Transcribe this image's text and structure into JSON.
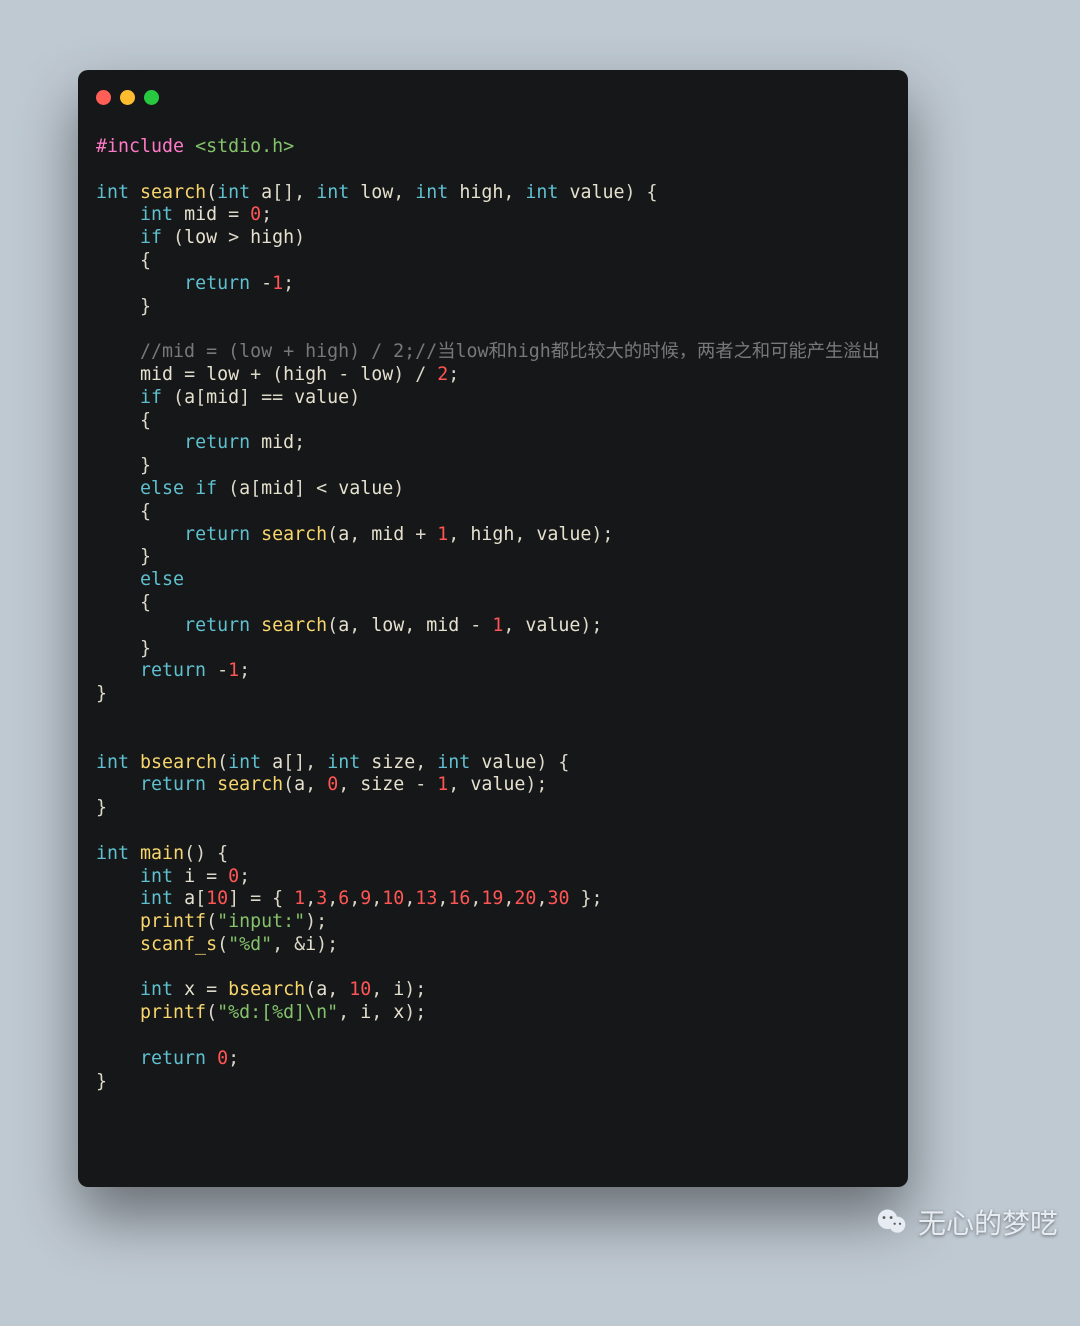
{
  "window": {
    "traffic_lights": [
      "red",
      "yellow",
      "green"
    ],
    "language": "c"
  },
  "code": {
    "tokens": [
      [
        [
          "pp",
          "#include"
        ],
        [
          "pun",
          " "
        ],
        [
          "inc",
          "<stdio.h>"
        ]
      ],
      [],
      [
        [
          "kw",
          "int"
        ],
        [
          "pun",
          " "
        ],
        [
          "fn",
          "search"
        ],
        [
          "pun",
          "("
        ],
        [
          "kw",
          "int"
        ],
        [
          "pun",
          " "
        ],
        [
          "var",
          "a"
        ],
        [
          "pun",
          "[], "
        ],
        [
          "kw",
          "int"
        ],
        [
          "pun",
          " "
        ],
        [
          "var",
          "low"
        ],
        [
          "pun",
          ", "
        ],
        [
          "kw",
          "int"
        ],
        [
          "pun",
          " "
        ],
        [
          "var",
          "high"
        ],
        [
          "pun",
          ", "
        ],
        [
          "kw",
          "int"
        ],
        [
          "pun",
          " "
        ],
        [
          "var",
          "value"
        ],
        [
          "pun",
          ") {"
        ]
      ],
      [
        [
          "pun",
          "    "
        ],
        [
          "kw",
          "int"
        ],
        [
          "pun",
          " "
        ],
        [
          "var",
          "mid"
        ],
        [
          "pun",
          " = "
        ],
        [
          "num",
          "0"
        ],
        [
          "pun",
          ";"
        ]
      ],
      [
        [
          "pun",
          "    "
        ],
        [
          "kw",
          "if"
        ],
        [
          "pun",
          " ("
        ],
        [
          "var",
          "low"
        ],
        [
          "pun",
          " > "
        ],
        [
          "var",
          "high"
        ],
        [
          "pun",
          ")"
        ]
      ],
      [
        [
          "pun",
          "    {"
        ]
      ],
      [
        [
          "pun",
          "        "
        ],
        [
          "kw",
          "return"
        ],
        [
          "pun",
          " -"
        ],
        [
          "num",
          "1"
        ],
        [
          "pun",
          ";"
        ]
      ],
      [
        [
          "pun",
          "    }"
        ]
      ],
      [],
      [
        [
          "pun",
          "    "
        ],
        [
          "cmt",
          "//mid = (low + high) / 2;//当low和high都比较大的时候，两者之和可能产生溢出"
        ]
      ],
      [
        [
          "pun",
          "    "
        ],
        [
          "var",
          "mid"
        ],
        [
          "pun",
          " = "
        ],
        [
          "var",
          "low"
        ],
        [
          "pun",
          " + ("
        ],
        [
          "var",
          "high"
        ],
        [
          "pun",
          " - "
        ],
        [
          "var",
          "low"
        ],
        [
          "pun",
          ") / "
        ],
        [
          "num",
          "2"
        ],
        [
          "pun",
          ";"
        ]
      ],
      [
        [
          "pun",
          "    "
        ],
        [
          "kw",
          "if"
        ],
        [
          "pun",
          " ("
        ],
        [
          "var",
          "a"
        ],
        [
          "pun",
          "["
        ],
        [
          "var",
          "mid"
        ],
        [
          "pun",
          "] == "
        ],
        [
          "var",
          "value"
        ],
        [
          "pun",
          ")"
        ]
      ],
      [
        [
          "pun",
          "    {"
        ]
      ],
      [
        [
          "pun",
          "        "
        ],
        [
          "kw",
          "return"
        ],
        [
          "pun",
          " "
        ],
        [
          "var",
          "mid"
        ],
        [
          "pun",
          ";"
        ]
      ],
      [
        [
          "pun",
          "    }"
        ]
      ],
      [
        [
          "pun",
          "    "
        ],
        [
          "kw",
          "else"
        ],
        [
          "pun",
          " "
        ],
        [
          "kw",
          "if"
        ],
        [
          "pun",
          " ("
        ],
        [
          "var",
          "a"
        ],
        [
          "pun",
          "["
        ],
        [
          "var",
          "mid"
        ],
        [
          "pun",
          "] < "
        ],
        [
          "var",
          "value"
        ],
        [
          "pun",
          ")"
        ]
      ],
      [
        [
          "pun",
          "    {"
        ]
      ],
      [
        [
          "pun",
          "        "
        ],
        [
          "kw",
          "return"
        ],
        [
          "pun",
          " "
        ],
        [
          "fn",
          "search"
        ],
        [
          "pun",
          "("
        ],
        [
          "var",
          "a"
        ],
        [
          "pun",
          ", "
        ],
        [
          "var",
          "mid"
        ],
        [
          "pun",
          " + "
        ],
        [
          "num",
          "1"
        ],
        [
          "pun",
          ", "
        ],
        [
          "var",
          "high"
        ],
        [
          "pun",
          ", "
        ],
        [
          "var",
          "value"
        ],
        [
          "pun",
          ");"
        ]
      ],
      [
        [
          "pun",
          "    }"
        ]
      ],
      [
        [
          "pun",
          "    "
        ],
        [
          "kw",
          "else"
        ]
      ],
      [
        [
          "pun",
          "    {"
        ]
      ],
      [
        [
          "pun",
          "        "
        ],
        [
          "kw",
          "return"
        ],
        [
          "pun",
          " "
        ],
        [
          "fn",
          "search"
        ],
        [
          "pun",
          "("
        ],
        [
          "var",
          "a"
        ],
        [
          "pun",
          ", "
        ],
        [
          "var",
          "low"
        ],
        [
          "pun",
          ", "
        ],
        [
          "var",
          "mid"
        ],
        [
          "pun",
          " - "
        ],
        [
          "num",
          "1"
        ],
        [
          "pun",
          ", "
        ],
        [
          "var",
          "value"
        ],
        [
          "pun",
          ");"
        ]
      ],
      [
        [
          "pun",
          "    }"
        ]
      ],
      [
        [
          "pun",
          "    "
        ],
        [
          "kw",
          "return"
        ],
        [
          "pun",
          " -"
        ],
        [
          "num",
          "1"
        ],
        [
          "pun",
          ";"
        ]
      ],
      [
        [
          "pun",
          "}"
        ]
      ],
      [],
      [],
      [
        [
          "kw",
          "int"
        ],
        [
          "pun",
          " "
        ],
        [
          "fn",
          "bsearch"
        ],
        [
          "pun",
          "("
        ],
        [
          "kw",
          "int"
        ],
        [
          "pun",
          " "
        ],
        [
          "var",
          "a"
        ],
        [
          "pun",
          "[], "
        ],
        [
          "kw",
          "int"
        ],
        [
          "pun",
          " "
        ],
        [
          "var",
          "size"
        ],
        [
          "pun",
          ", "
        ],
        [
          "kw",
          "int"
        ],
        [
          "pun",
          " "
        ],
        [
          "var",
          "value"
        ],
        [
          "pun",
          ") {"
        ]
      ],
      [
        [
          "pun",
          "    "
        ],
        [
          "kw",
          "return"
        ],
        [
          "pun",
          " "
        ],
        [
          "fn",
          "search"
        ],
        [
          "pun",
          "("
        ],
        [
          "var",
          "a"
        ],
        [
          "pun",
          ", "
        ],
        [
          "num",
          "0"
        ],
        [
          "pun",
          ", "
        ],
        [
          "var",
          "size"
        ],
        [
          "pun",
          " - "
        ],
        [
          "num",
          "1"
        ],
        [
          "pun",
          ", "
        ],
        [
          "var",
          "value"
        ],
        [
          "pun",
          ");"
        ]
      ],
      [
        [
          "pun",
          "}"
        ]
      ],
      [],
      [
        [
          "kw",
          "int"
        ],
        [
          "pun",
          " "
        ],
        [
          "fn",
          "main"
        ],
        [
          "pun",
          "() {"
        ]
      ],
      [
        [
          "pun",
          "    "
        ],
        [
          "kw",
          "int"
        ],
        [
          "pun",
          " "
        ],
        [
          "var",
          "i"
        ],
        [
          "pun",
          " = "
        ],
        [
          "num",
          "0"
        ],
        [
          "pun",
          ";"
        ]
      ],
      [
        [
          "pun",
          "    "
        ],
        [
          "kw",
          "int"
        ],
        [
          "pun",
          " "
        ],
        [
          "var",
          "a"
        ],
        [
          "pun",
          "["
        ],
        [
          "num",
          "10"
        ],
        [
          "pun",
          "] = { "
        ],
        [
          "num",
          "1"
        ],
        [
          "pun",
          ","
        ],
        [
          "num",
          "3"
        ],
        [
          "pun",
          ","
        ],
        [
          "num",
          "6"
        ],
        [
          "pun",
          ","
        ],
        [
          "num",
          "9"
        ],
        [
          "pun",
          ","
        ],
        [
          "num",
          "10"
        ],
        [
          "pun",
          ","
        ],
        [
          "num",
          "13"
        ],
        [
          "pun",
          ","
        ],
        [
          "num",
          "16"
        ],
        [
          "pun",
          ","
        ],
        [
          "num",
          "19"
        ],
        [
          "pun",
          ","
        ],
        [
          "num",
          "20"
        ],
        [
          "pun",
          ","
        ],
        [
          "num",
          "30"
        ],
        [
          "pun",
          " };"
        ]
      ],
      [
        [
          "pun",
          "    "
        ],
        [
          "fn",
          "printf"
        ],
        [
          "pun",
          "("
        ],
        [
          "str",
          "\"input:\""
        ],
        [
          "pun",
          ");"
        ]
      ],
      [
        [
          "pun",
          "    "
        ],
        [
          "fn",
          "scanf_s"
        ],
        [
          "pun",
          "("
        ],
        [
          "str",
          "\"%d\""
        ],
        [
          "pun",
          ", &"
        ],
        [
          "var",
          "i"
        ],
        [
          "pun",
          ");"
        ]
      ],
      [],
      [
        [
          "pun",
          "    "
        ],
        [
          "kw",
          "int"
        ],
        [
          "pun",
          " "
        ],
        [
          "var",
          "x"
        ],
        [
          "pun",
          " = "
        ],
        [
          "fn",
          "bsearch"
        ],
        [
          "pun",
          "("
        ],
        [
          "var",
          "a"
        ],
        [
          "pun",
          ", "
        ],
        [
          "num",
          "10"
        ],
        [
          "pun",
          ", "
        ],
        [
          "var",
          "i"
        ],
        [
          "pun",
          ");"
        ]
      ],
      [
        [
          "pun",
          "    "
        ],
        [
          "fn",
          "printf"
        ],
        [
          "pun",
          "("
        ],
        [
          "str",
          "\"%d:[%d]\\n\""
        ],
        [
          "pun",
          ", "
        ],
        [
          "var",
          "i"
        ],
        [
          "pun",
          ", "
        ],
        [
          "var",
          "x"
        ],
        [
          "pun",
          ");"
        ]
      ],
      [],
      [
        [
          "pun",
          "    "
        ],
        [
          "kw",
          "return"
        ],
        [
          "pun",
          " "
        ],
        [
          "num",
          "0"
        ],
        [
          "pun",
          ";"
        ]
      ],
      [
        [
          "pun",
          "}"
        ]
      ]
    ]
  },
  "watermark": {
    "text": "无心的梦呓",
    "icon": "wechat-icon"
  }
}
